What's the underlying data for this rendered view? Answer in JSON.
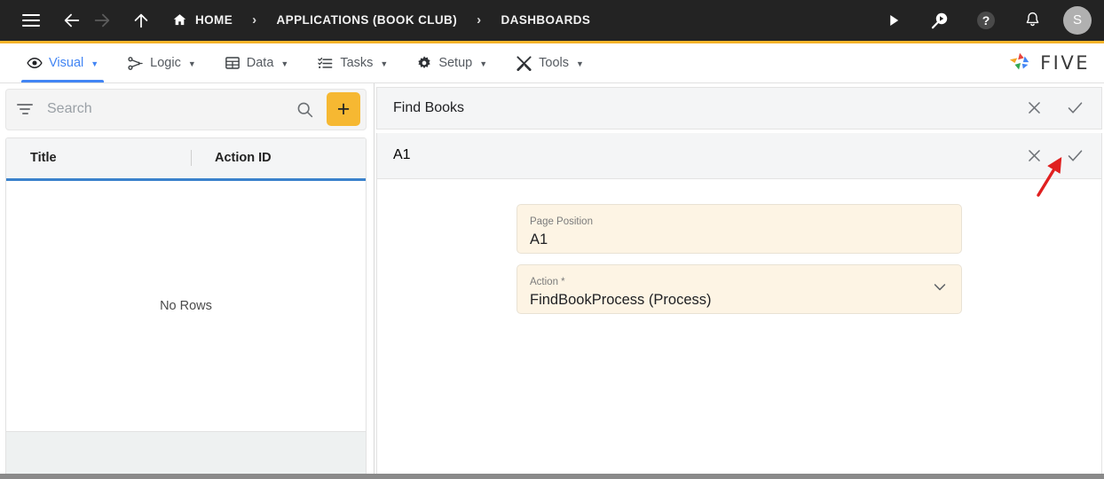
{
  "topbar": {
    "menu_icon": "hamburger-icon",
    "back_icon": "arrow-left-icon",
    "forward_icon": "arrow-right-icon",
    "up_icon": "arrow-up-icon",
    "home_icon": "home-icon",
    "breadcrumbs": [
      {
        "label": "HOME",
        "has_home_icon": true
      },
      {
        "label": "APPLICATIONS (BOOK CLUB)",
        "has_home_icon": false
      },
      {
        "label": "DASHBOARDS",
        "has_home_icon": false
      }
    ],
    "separator": "›",
    "actions": [
      {
        "name": "run-button",
        "icon": "play-icon"
      },
      {
        "name": "search-preview-button",
        "icon": "search-play-icon"
      },
      {
        "name": "help-button",
        "icon": "question-circle-icon"
      },
      {
        "name": "notifications-button",
        "icon": "bell-icon"
      }
    ],
    "avatar_initial": "S",
    "accent_color": "#f6b42a",
    "background_color": "#232323"
  },
  "menubar": {
    "items": [
      {
        "label": "Visual",
        "icon": "eye-icon",
        "caret": "▼",
        "active": true
      },
      {
        "label": "Logic",
        "icon": "logic-nodes-icon",
        "caret": "▼",
        "active": false
      },
      {
        "label": "Data",
        "icon": "table-grid-icon",
        "caret": "▼",
        "active": false
      },
      {
        "label": "Tasks",
        "icon": "checklist-icon",
        "caret": "▼",
        "active": false
      },
      {
        "label": "Setup",
        "icon": "gear-icon",
        "caret": "▼",
        "active": false
      },
      {
        "label": "Tools",
        "icon": "tools-cross-icon",
        "caret": "▼",
        "active": false
      }
    ],
    "active_color": "#4285f4",
    "brand": {
      "text": "FIVE",
      "logo_icon": "five-pinwheel-logo"
    }
  },
  "left_panel": {
    "filter_icon": "filter-icon",
    "search": {
      "placeholder": "Search",
      "value": ""
    },
    "search_icon": "search-icon",
    "add_button": {
      "label": "+",
      "name": "add-record-button",
      "color": "#f6b832"
    },
    "grid": {
      "columns": [
        "Title",
        "Action ID"
      ],
      "rows": [],
      "empty_message": "No Rows"
    }
  },
  "right_panel": {
    "header": {
      "title": "Find Books",
      "close_icon": "close-icon",
      "confirm_icon": "check-icon"
    },
    "sub_header": {
      "title": "A1",
      "close_icon": "close-icon",
      "confirm_icon": "check-icon"
    },
    "fields": [
      {
        "label": "Page Position",
        "value": "A1",
        "type": "text",
        "name": "page-position-field"
      },
      {
        "label": "Action *",
        "value": "FindBookProcess (Process)",
        "type": "select",
        "name": "action-field",
        "chevron": "chevron-down-icon"
      }
    ],
    "field_background": "#fdf4e4"
  },
  "annotation": {
    "arrow_color": "#e02020",
    "points_to": "sub-header-confirm-button"
  }
}
